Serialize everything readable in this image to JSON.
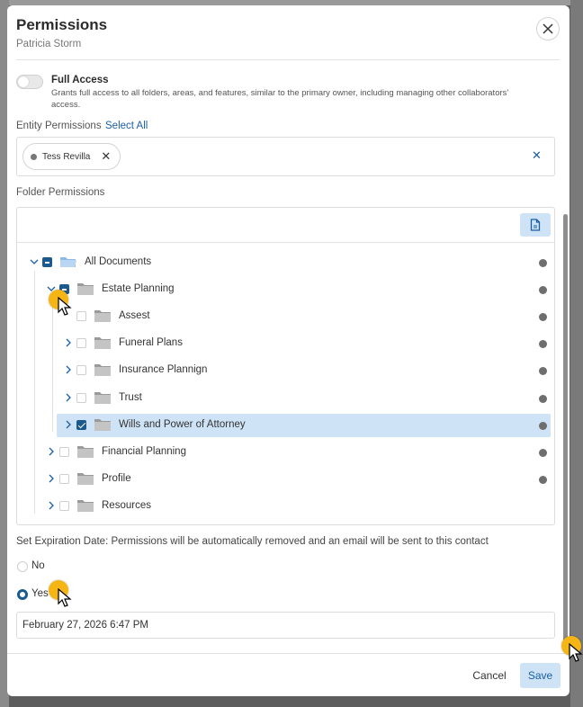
{
  "dialog": {
    "title": "Permissions",
    "subtitle": "Patricia Storm",
    "close_icon": "close-icon"
  },
  "full_access": {
    "label": "Full Access",
    "description": "Grants full access to all folders, areas, and features, similar to the primary owner, including managing other collaborators' access.",
    "enabled": false
  },
  "entity_permissions": {
    "label": "Entity Permissions",
    "select_all": "Select All",
    "chips": [
      {
        "name": "Tess Revilla"
      }
    ]
  },
  "folder_permissions": {
    "label": "Folder Permissions",
    "upload_icon": "file-icon",
    "tree": [
      {
        "label": "All Documents",
        "level": 0,
        "expanded": true,
        "check": "indeterminate",
        "folder": "open"
      },
      {
        "label": "Estate Planning",
        "level": 1,
        "expanded": true,
        "check": "indeterminate",
        "folder": "closed"
      },
      {
        "label": "Assest",
        "level": 2,
        "expanded": false,
        "check": "unchecked",
        "folder": "closed",
        "no_chevron": true
      },
      {
        "label": "Funeral Plans",
        "level": 2,
        "expanded": false,
        "check": "unchecked",
        "folder": "closed"
      },
      {
        "label": "Insurance Plannign",
        "level": 2,
        "expanded": false,
        "check": "unchecked",
        "folder": "closed"
      },
      {
        "label": "Trust",
        "level": 2,
        "expanded": false,
        "check": "unchecked",
        "folder": "closed"
      },
      {
        "label": "Wills and Power of Attorney",
        "level": 2,
        "expanded": false,
        "check": "checked",
        "folder": "closed",
        "selected": true
      },
      {
        "label": "Financial Planning",
        "level": 1,
        "expanded": false,
        "check": "unchecked",
        "folder": "closed"
      },
      {
        "label": "Profile",
        "level": 1,
        "expanded": false,
        "check": "unchecked",
        "folder": "closed"
      },
      {
        "label": "Resources",
        "level": 1,
        "expanded": false,
        "check": "unchecked",
        "folder": "closed",
        "no_dot": true
      }
    ]
  },
  "expiration": {
    "label": "Set Expiration Date: Permissions will be automatically removed and an email will be sent to this contact",
    "options": [
      {
        "label": "No",
        "selected": false
      },
      {
        "label": "Yes",
        "selected": true
      }
    ],
    "date_value": "February 27, 2026 6:47 PM"
  },
  "footer": {
    "cancel_label": "Cancel",
    "save_label": "Save"
  },
  "colors": {
    "accent": "#1a5fa5",
    "checkbox_fill": "#1b5a8e",
    "selected_row": "#cfe3f7",
    "cursor_marker": "#f5b514"
  }
}
